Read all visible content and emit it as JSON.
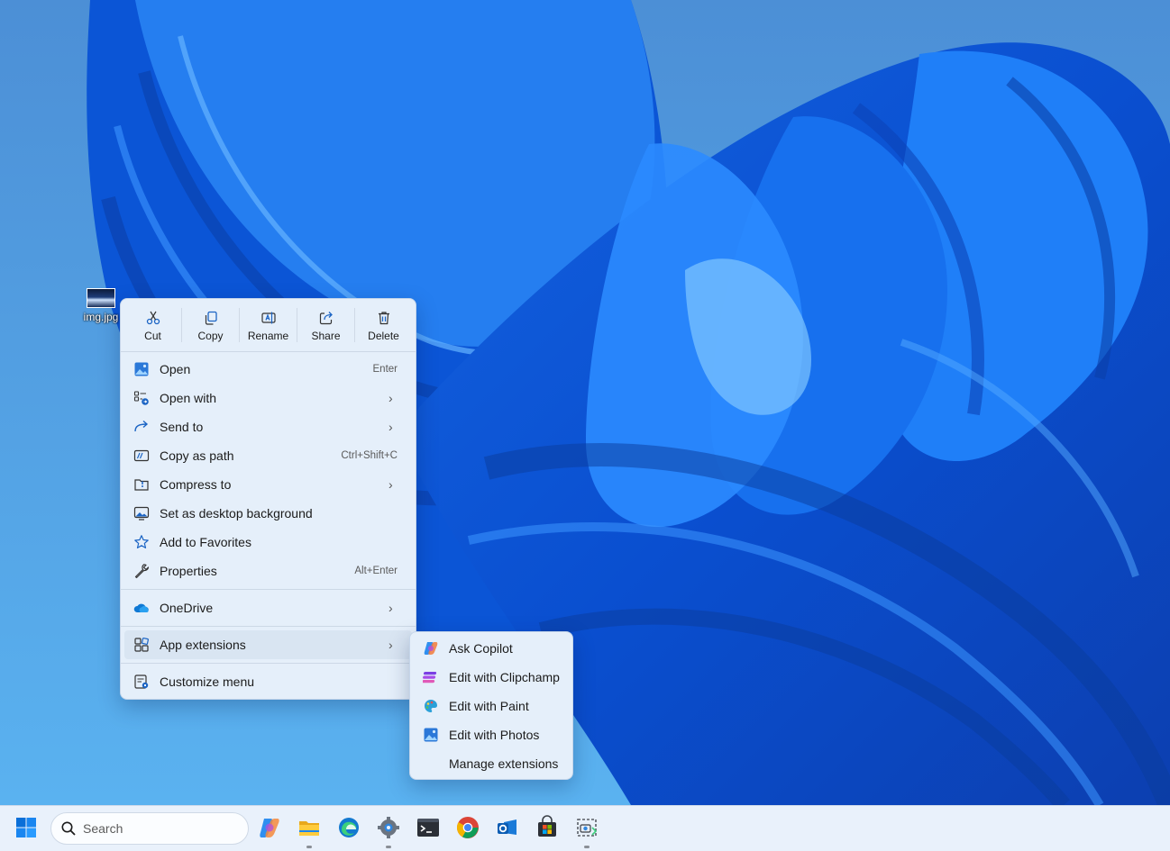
{
  "desktop": {
    "icon_label": "img.jpg"
  },
  "context_menu": {
    "quick_actions": [
      {
        "label": "Cut",
        "icon": "scissors-icon"
      },
      {
        "label": "Copy",
        "icon": "copy-icon"
      },
      {
        "label": "Rename",
        "icon": "rename-icon"
      },
      {
        "label": "Share",
        "icon": "share-icon"
      },
      {
        "label": "Delete",
        "icon": "trash-icon"
      }
    ],
    "items": [
      {
        "label": "Open",
        "accelerator": "Enter",
        "icon": "photos-icon"
      },
      {
        "label": "Open with",
        "icon": "open-with-icon",
        "submenu": true
      },
      {
        "label": "Send to",
        "icon": "send-arrow-icon",
        "submenu": true
      },
      {
        "label": "Copy as path",
        "accelerator": "Ctrl+Shift+C",
        "icon": "copy-path-icon"
      },
      {
        "label": "Compress to",
        "icon": "compress-icon",
        "submenu": true
      },
      {
        "label": "Set as desktop background",
        "icon": "desktop-background-icon"
      },
      {
        "label": "Add to Favorites",
        "icon": "star-icon"
      },
      {
        "label": "Properties",
        "accelerator": "Alt+Enter",
        "icon": "wrench-icon"
      },
      {
        "label": "OneDrive",
        "icon": "onedrive-cloud-icon",
        "submenu": true
      },
      {
        "label": "App extensions",
        "icon": "app-extensions-icon",
        "submenu": true
      },
      {
        "label": "Customize menu",
        "icon": "customize-menu-icon"
      }
    ]
  },
  "app_extensions_submenu": {
    "items": [
      {
        "label": "Ask Copilot",
        "icon": "copilot-icon"
      },
      {
        "label": "Edit with Clipchamp",
        "icon": "clipchamp-icon"
      },
      {
        "label": "Edit with Paint",
        "icon": "paint-icon"
      },
      {
        "label": "Edit with Photos",
        "icon": "photos-icon"
      },
      {
        "label": "Manage extensions",
        "icon": ""
      }
    ]
  },
  "taskbar": {
    "search_placeholder": "Search",
    "apps": [
      "copilot-icon",
      "file-explorer-icon",
      "edge-icon",
      "settings-gear-icon",
      "terminal-icon",
      "chrome-icon",
      "outlook-icon",
      "store-icon",
      "snipping-tool-icon"
    ]
  },
  "colors": {
    "accent": "#0067c0",
    "menu_background": "#e5effa",
    "wallpaper_base": "#4aa3ea"
  }
}
